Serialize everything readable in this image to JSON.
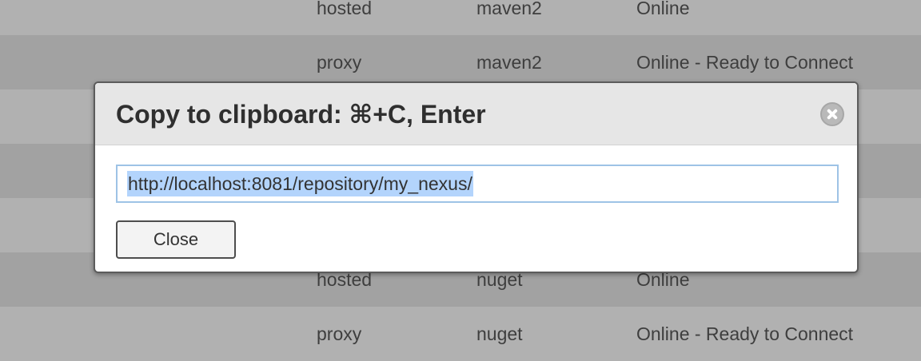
{
  "background_table": {
    "rows": [
      {
        "type": "hosted",
        "format": "maven2",
        "status": "Online"
      },
      {
        "type": "proxy",
        "format": "maven2",
        "status": "Online - Ready to Connect"
      },
      {
        "type": "",
        "format": "",
        "status": ""
      },
      {
        "type": "",
        "format": "",
        "status": ""
      },
      {
        "type": "",
        "format": "",
        "status": ""
      },
      {
        "type": "hosted",
        "format": "nuget",
        "status": "Online"
      },
      {
        "type": "proxy",
        "format": "nuget",
        "status": "Online - Ready to Connect"
      }
    ]
  },
  "dialog": {
    "title": "Copy to clipboard: ⌘+C, Enter",
    "url_value": "http://localhost:8081/repository/my_nexus/",
    "close_label": "Close",
    "close_icon": "close-circle-icon"
  },
  "colors": {
    "selection": "#b3d4fc",
    "field_border": "#9ec3e6",
    "header_bg": "#e6e6e6",
    "mask": "#a6a6a6"
  }
}
